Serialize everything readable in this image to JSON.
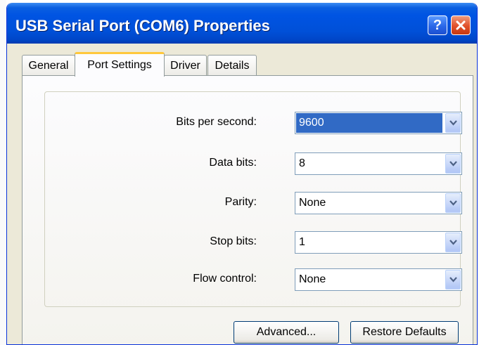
{
  "window": {
    "title": "USB Serial Port (COM6) Properties"
  },
  "titlebar_buttons": {
    "help": "?",
    "close_icon": "close-icon"
  },
  "tabs": [
    {
      "label": "General",
      "active": false
    },
    {
      "label": "Port Settings",
      "active": true
    },
    {
      "label": "Driver",
      "active": false
    },
    {
      "label": "Details",
      "active": false
    }
  ],
  "settings": [
    {
      "label": "Bits per second:",
      "value": "9600",
      "selected": true
    },
    {
      "label": "Data bits:",
      "value": "8"
    },
    {
      "label": "Parity:",
      "value": "None"
    },
    {
      "label": "Stop bits:",
      "value": "1"
    },
    {
      "label": "Flow control:",
      "value": "None"
    }
  ],
  "buttons": {
    "advanced": "Advanced...",
    "restore_defaults": "Restore Defaults"
  },
  "colors": {
    "titlebar": "#0054e3",
    "selection": "#316ac5",
    "active_tab_accent": "#ffc83c",
    "close_button": "#e0502a"
  }
}
